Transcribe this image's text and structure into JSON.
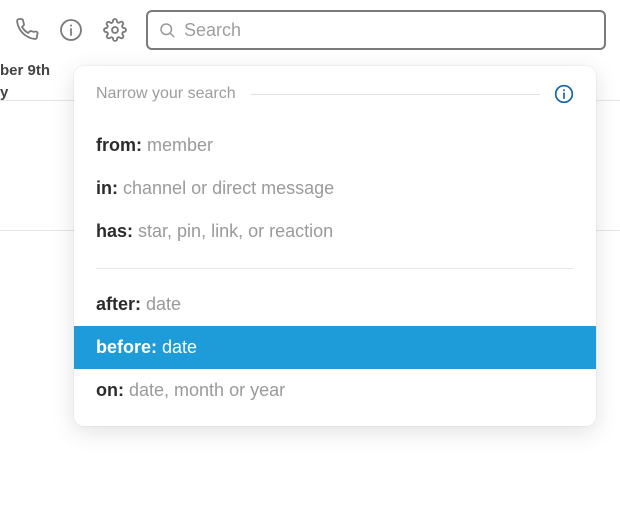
{
  "bg_fragments": {
    "line1": "ber 9th",
    "line2": "y"
  },
  "search": {
    "placeholder": "Search",
    "value": ""
  },
  "dropdown": {
    "header_label": "Narrow your search",
    "items_group1": [
      {
        "key": "from:",
        "val": "member",
        "selected": false
      },
      {
        "key": "in:",
        "val": "channel or direct message",
        "selected": false
      },
      {
        "key": "has:",
        "val": "star, pin, link, or reaction",
        "selected": false
      }
    ],
    "items_group2": [
      {
        "key": "after:",
        "val": "date",
        "selected": false
      },
      {
        "key": "before:",
        "val": "date",
        "selected": true
      },
      {
        "key": "on:",
        "val": "date, month or year",
        "selected": false
      }
    ]
  },
  "colors": {
    "highlight": "#1e9bd9",
    "info_icon": "#1264a3"
  }
}
